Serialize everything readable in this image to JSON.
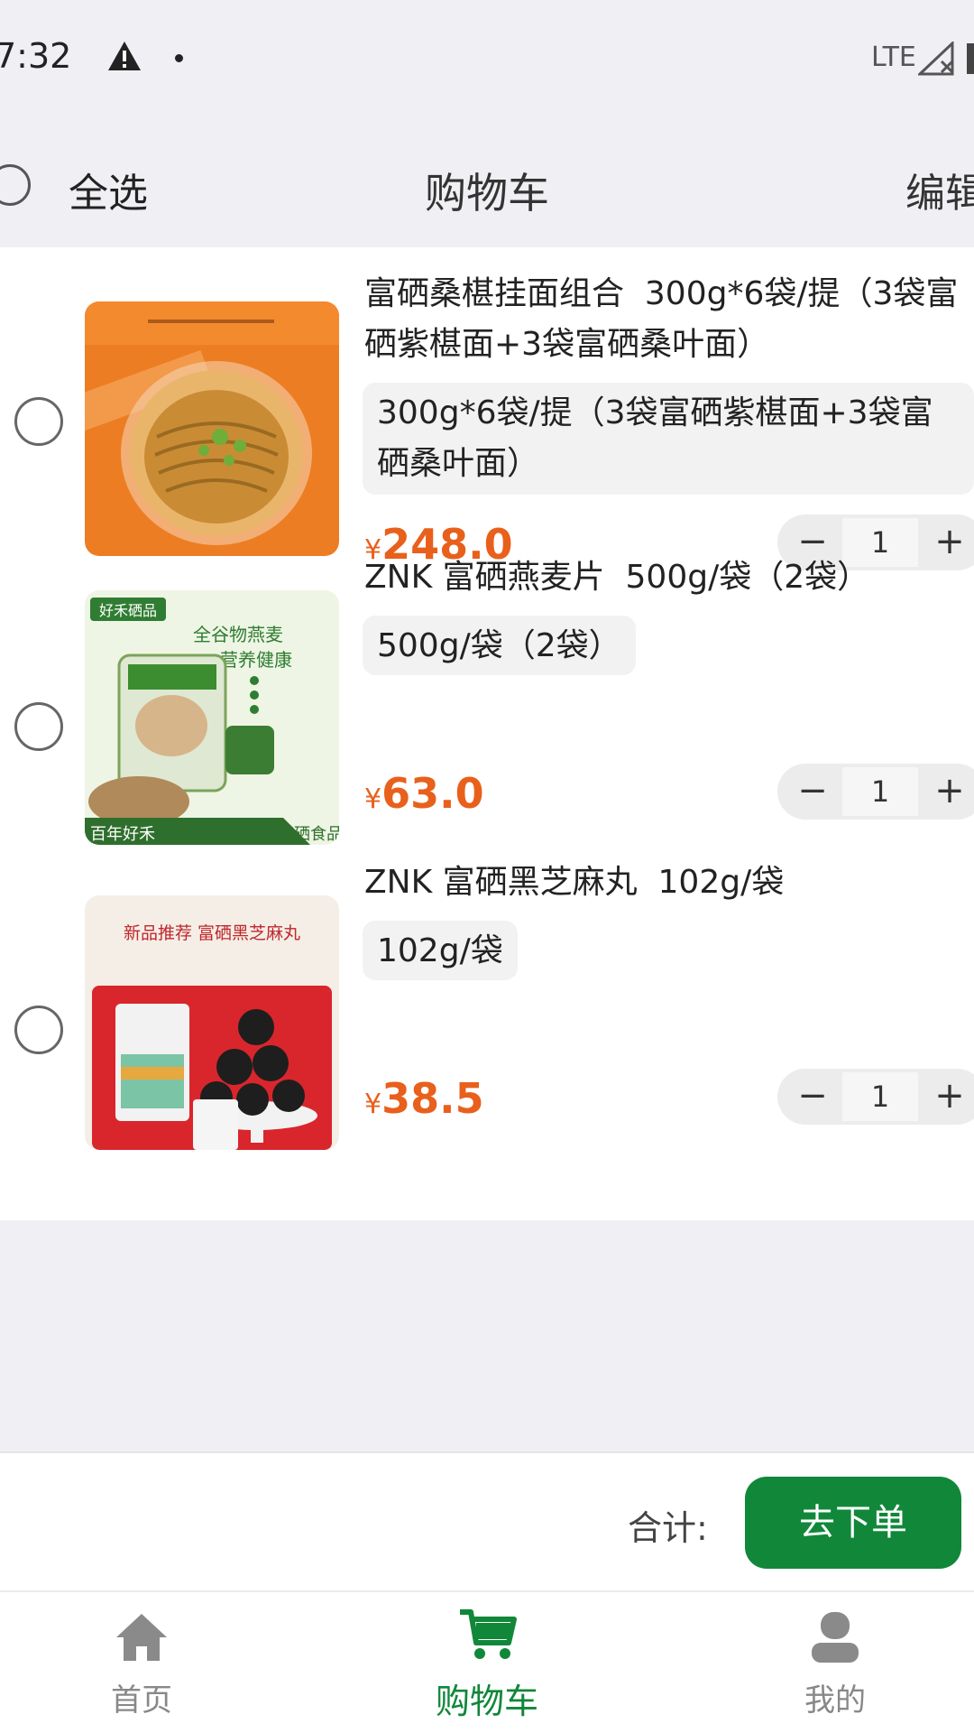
{
  "status_bar": {
    "time": "7:32",
    "network": "LTE",
    "icons": [
      "warning-icon",
      "signal-icon",
      "battery-icon"
    ]
  },
  "header": {
    "select_all_label": "全选",
    "title": "购物车",
    "edit_label": "编辑"
  },
  "cart": {
    "items": [
      {
        "title": "富硒桑椹挂面组合  300g*6袋/提（3袋富硒紫椹面+3袋富硒桑叶面）",
        "spec": "300g*6袋/提（3袋富硒紫椹面+3袋富硒桑叶面）",
        "currency": "¥",
        "price": "248.0",
        "quantity": "1",
        "minus": "−",
        "plus": "+",
        "image": "mulberry-noodles-bowl"
      },
      {
        "title": "ZNK 富硒燕麦片  500g/袋（2袋）",
        "spec": "500g/袋（2袋）",
        "currency": "¥",
        "price": "63.0",
        "quantity": "1",
        "minus": "−",
        "plus": "+",
        "image": "oatmeal-package",
        "image_text": [
          "好禾硒品",
          "全谷物燕麦",
          "营养健康",
          "百年好禾",
          "富硒食品"
        ]
      },
      {
        "title": "ZNK 富硒黑芝麻丸  102g/袋",
        "spec": "102g/袋",
        "currency": "¥",
        "price": "38.5",
        "quantity": "1",
        "minus": "−",
        "plus": "+",
        "image": "black-sesame-balls",
        "image_text": [
          "新品推荐 富硒黑芝麻丸"
        ]
      }
    ]
  },
  "checkout": {
    "total_label": "合计:",
    "total_value": "",
    "button_label": "去下单"
  },
  "tabs": [
    {
      "label": "首页",
      "icon": "home-icon",
      "active": false
    },
    {
      "label": "购物车",
      "icon": "cart-icon",
      "active": true
    },
    {
      "label": "我的",
      "icon": "user-icon",
      "active": false
    }
  ],
  "colors": {
    "accent": "#11873a",
    "price": "#e8601c",
    "background": "#efeff4"
  }
}
